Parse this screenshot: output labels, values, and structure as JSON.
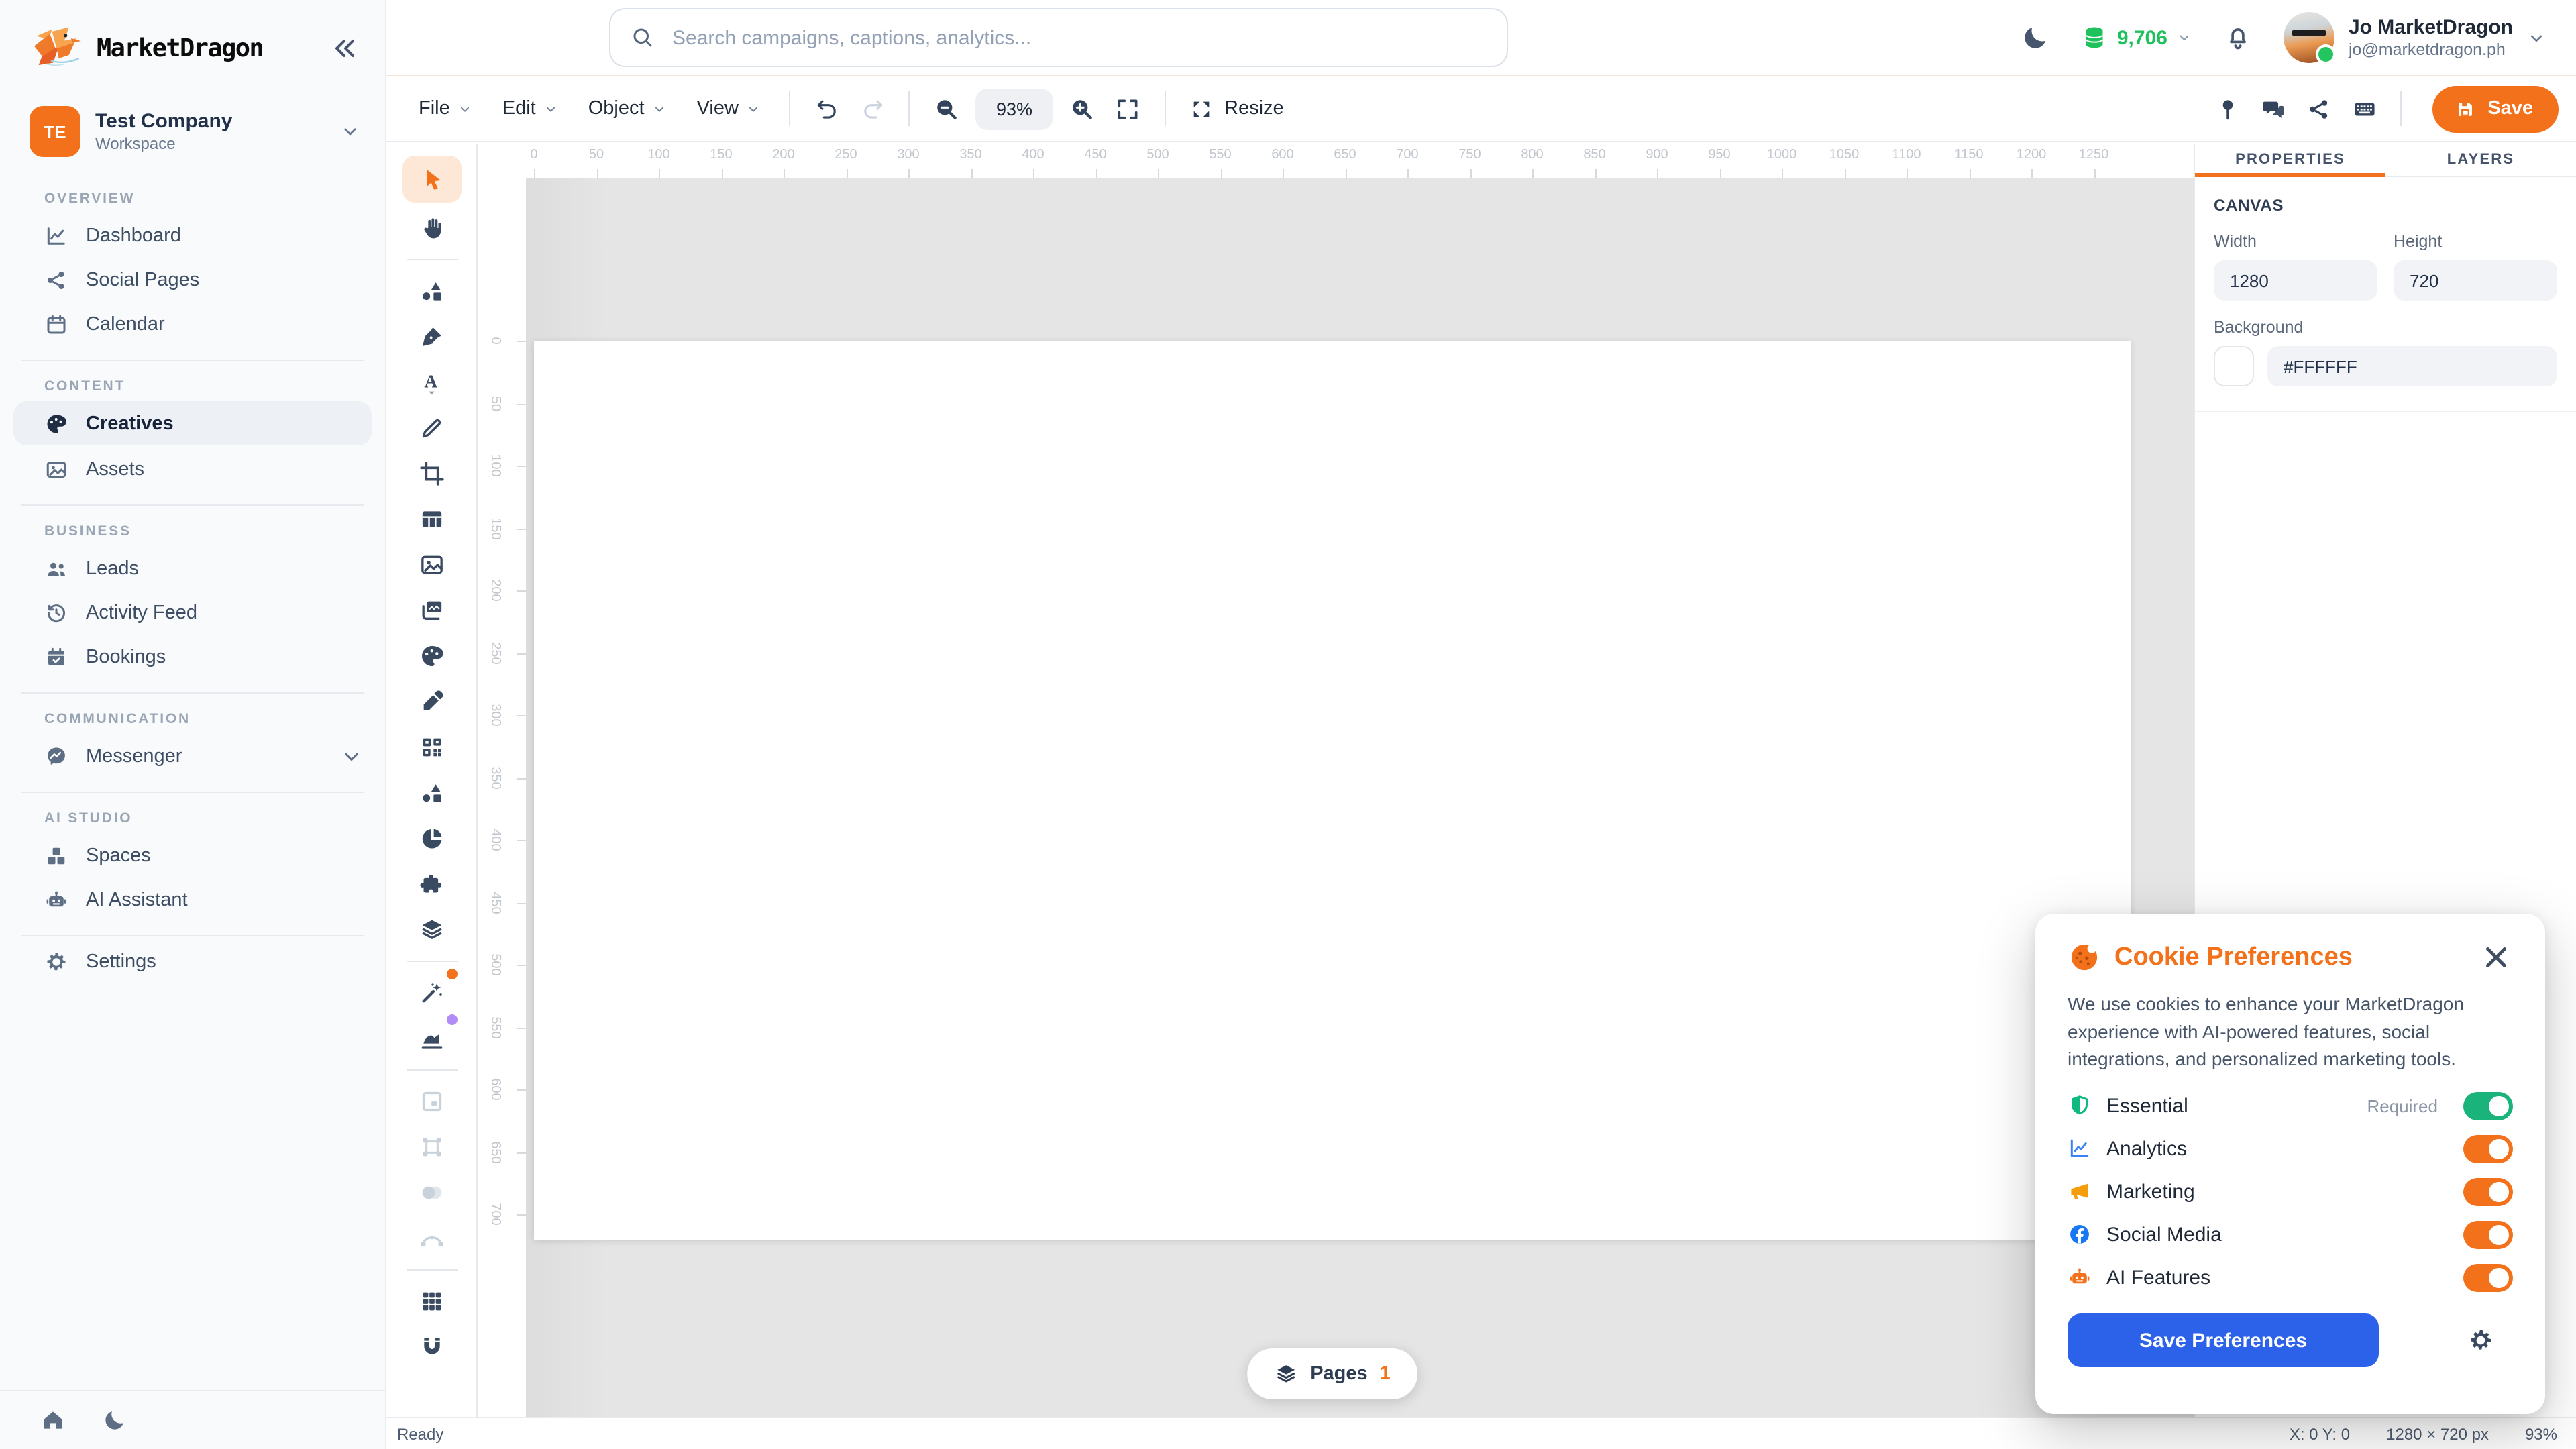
{
  "brand": {
    "name": "MarketDragon"
  },
  "workspace": {
    "initials": "TE",
    "name": "Test Company",
    "type": "Workspace"
  },
  "sidebar": {
    "sections": [
      {
        "label": "OVERVIEW",
        "items": [
          {
            "label": "Dashboard",
            "icon": "dashboard"
          },
          {
            "label": "Social Pages",
            "icon": "share-nodes"
          },
          {
            "label": "Calendar",
            "icon": "calendar"
          }
        ]
      },
      {
        "label": "CONTENT",
        "items": [
          {
            "label": "Creatives",
            "icon": "palette",
            "active": true
          },
          {
            "label": "Assets",
            "icon": "image"
          }
        ]
      },
      {
        "label": "BUSINESS",
        "items": [
          {
            "label": "Leads",
            "icon": "users"
          },
          {
            "label": "Activity Feed",
            "icon": "history"
          },
          {
            "label": "Bookings",
            "icon": "calendar-check"
          }
        ]
      },
      {
        "label": "COMMUNICATION",
        "items": [
          {
            "label": "Messenger",
            "icon": "messenger",
            "chevron": true
          }
        ]
      },
      {
        "label": "AI STUDIO",
        "items": [
          {
            "label": "Spaces",
            "icon": "cubes"
          },
          {
            "label": "AI Assistant",
            "icon": "robot"
          }
        ]
      }
    ],
    "settings": {
      "label": "Settings",
      "icon": "gear"
    }
  },
  "topbar": {
    "search_placeholder": "Search campaigns, captions, analytics...",
    "credits": "9,706",
    "user": {
      "name": "Jo MarketDragon",
      "email": "jo@marketdragon.ph"
    }
  },
  "menubar": {
    "menus": [
      {
        "label": "File"
      },
      {
        "label": "Edit"
      },
      {
        "label": "Object"
      },
      {
        "label": "View"
      }
    ],
    "zoom_level": "93%",
    "resize_label": "Resize",
    "save_label": "Save"
  },
  "toolbar": {
    "groups": [
      {
        "items": [
          {
            "icon": "cursor",
            "name": "select-tool",
            "active": true
          },
          {
            "icon": "hand",
            "name": "hand-tool"
          }
        ]
      },
      {
        "items": [
          {
            "icon": "shapes",
            "name": "shapes-tool"
          },
          {
            "icon": "pen-nib",
            "name": "pen-tool"
          },
          {
            "icon": "text",
            "name": "text-tool"
          },
          {
            "icon": "pencil",
            "name": "pencil-tool"
          },
          {
            "icon": "crop",
            "name": "crop-tool"
          },
          {
            "icon": "table",
            "name": "table-tool"
          },
          {
            "icon": "image",
            "name": "image-tool"
          },
          {
            "icon": "gallery",
            "name": "gallery-tool"
          },
          {
            "icon": "palette",
            "name": "palette-tool"
          },
          {
            "icon": "eyedropper",
            "name": "eyedropper-tool"
          },
          {
            "icon": "qr",
            "name": "qr-code-tool"
          },
          {
            "icon": "shapes",
            "name": "elements-tool"
          },
          {
            "icon": "pie",
            "name": "chart-tool"
          },
          {
            "icon": "puzzle",
            "name": "plugin-tool"
          },
          {
            "icon": "layers",
            "name": "layers-tool"
          }
        ]
      },
      {
        "items": [
          {
            "icon": "wand",
            "name": "magic-wand-tool",
            "dot": "#F4711C"
          },
          {
            "icon": "trace",
            "name": "auto-trace-tool",
            "dot": "#b18cf7"
          }
        ]
      },
      {
        "items": [
          {
            "icon": "frame",
            "name": "frame-tool",
            "disabled": true
          },
          {
            "icon": "transform",
            "name": "transform-tool",
            "disabled": true
          },
          {
            "icon": "mask",
            "name": "mask-tool",
            "disabled": true
          },
          {
            "icon": "bezier",
            "name": "bezier-tool",
            "disabled": true
          }
        ]
      },
      {
        "items": [
          {
            "icon": "grid",
            "name": "grid-toggle-tool"
          },
          {
            "icon": "magnet",
            "name": "snap-toggle-tool"
          }
        ]
      }
    ]
  },
  "rulers": {
    "horizontal": {
      "start": 0,
      "end": 1250,
      "step": 50
    },
    "vertical": {
      "start": 0,
      "end": 700,
      "step": 50
    },
    "scale": 0.93
  },
  "panel": {
    "tabs": [
      "PROPERTIES",
      "LAYERS"
    ],
    "active_tab": "PROPERTIES",
    "section_title": "CANVAS",
    "width_label": "Width",
    "width_value": "1280",
    "height_label": "Height",
    "height_value": "720",
    "background_label": "Background",
    "background_value": "#FFFFFF"
  },
  "pages": {
    "label": "Pages",
    "count": "1"
  },
  "statusbar": {
    "status": "Ready",
    "coords": "X: 0 Y: 0",
    "size": "1280 × 720 px",
    "zoom": "93%"
  },
  "cookie_dialog": {
    "title": "Cookie Preferences",
    "description": "We use cookies to enhance your MarketDragon experience with AI-powered features, social integrations, and personalized marketing tools.",
    "items": [
      {
        "label": "Essential",
        "icon": "shield",
        "icon_color": "#10B981",
        "note": "Required",
        "toggle_color": "#19B37B"
      },
      {
        "label": "Analytics",
        "icon": "chart-line",
        "icon_color": "#3B82F6",
        "toggle_color": "#F4711C"
      },
      {
        "label": "Marketing",
        "icon": "megaphone",
        "icon_color": "#F59E0B",
        "toggle_color": "#F4711C"
      },
      {
        "label": "Social Media",
        "icon": "facebook",
        "icon_color": "#1877F2",
        "toggle_color": "#F4711C"
      },
      {
        "label": "AI Features",
        "icon": "robot",
        "icon_color": "#F4711C",
        "toggle_color": "#F4711C"
      }
    ],
    "save_label": "Save Preferences"
  },
  "colors": {
    "accent": "#F4711C",
    "save_blue": "#2B62E9",
    "credits_green": "#1FC15D"
  }
}
